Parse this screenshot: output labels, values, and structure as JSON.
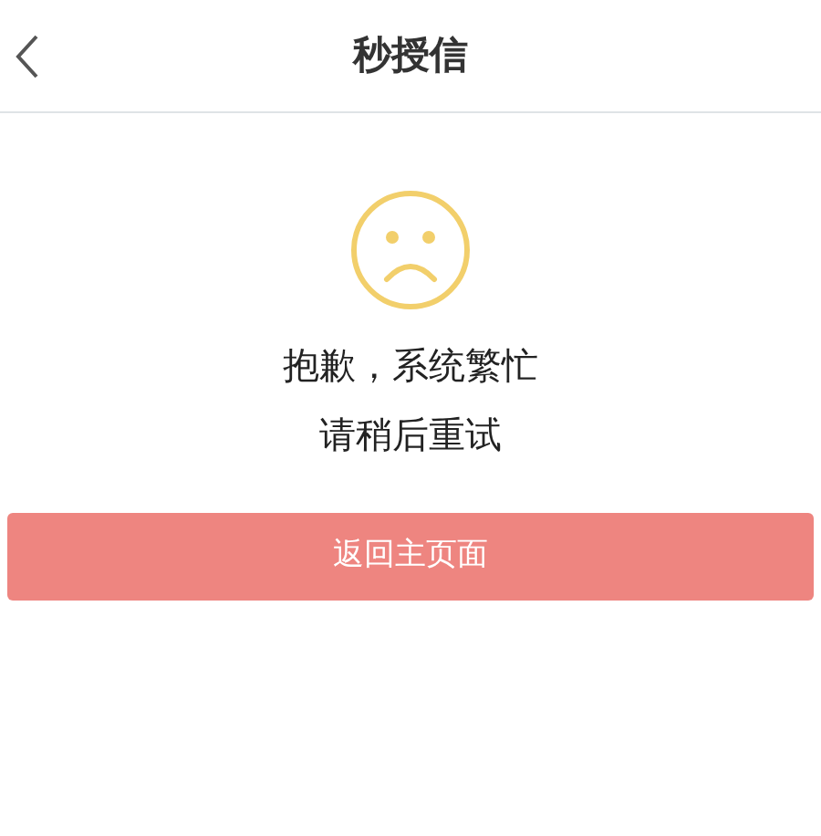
{
  "header": {
    "title": "秒授信"
  },
  "message": {
    "lines": [
      "抱歉，系统繁忙",
      "请稍后重试"
    ]
  },
  "button": {
    "label": "返回主页面"
  }
}
